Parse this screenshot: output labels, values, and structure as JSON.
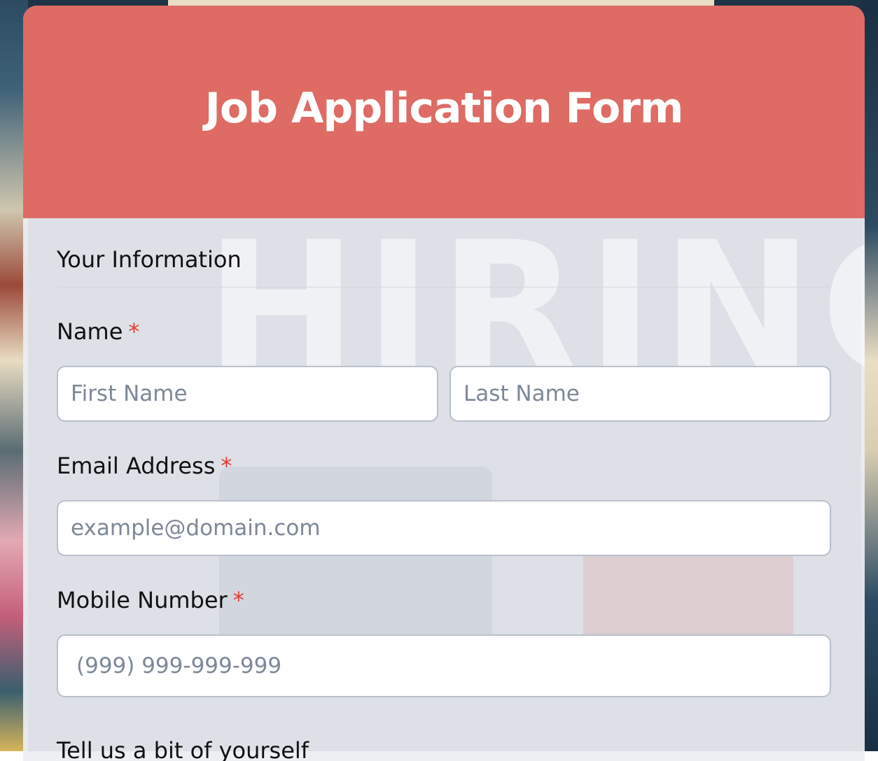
{
  "form": {
    "title": "Job Application Form",
    "section_title": "Your Information",
    "required_marker": "*",
    "name": {
      "label": "Name",
      "first_placeholder": "First Name",
      "last_placeholder": "Last Name"
    },
    "email": {
      "label": "Email Address",
      "placeholder": "example@domain.com"
    },
    "mobile": {
      "label": "Mobile Number",
      "placeholder": "(999) 999-999-999"
    },
    "next_label_partial": "Tell us a bit of yourself"
  },
  "background": {
    "watermark_text": "HIRING"
  },
  "colors": {
    "header": "#de6b64",
    "required": "#e23b32",
    "input_border": "#b8c0cb",
    "placeholder": "#7d8899"
  }
}
